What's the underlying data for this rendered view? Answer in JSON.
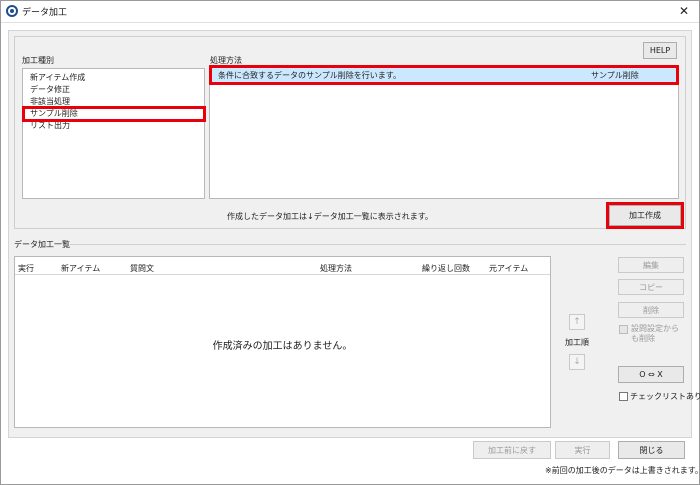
{
  "window": {
    "title": "データ加工",
    "close_glyph": "✕"
  },
  "processing_type": {
    "header": "加工種別",
    "items": [
      "新アイテム作成",
      "データ修正",
      "非該当処理",
      "サンプル削除",
      "リスト出力"
    ],
    "selected_index": 3
  },
  "method": {
    "header": "処理方法",
    "help_label": "HELP",
    "row_description": "条件に合致するデータのサンプル削除を行います。",
    "row_name": "サンプル削除"
  },
  "info_text": "作成したデータ加工は↓データ加工一覧に表示されます。",
  "create_button": "加工作成",
  "list": {
    "header": "データ加工一覧",
    "columns": [
      "実行",
      "新アイテム",
      "質問文",
      "処理方法",
      "繰り返し回数",
      "元アイテム"
    ],
    "empty_message": "作成済みの加工はありません。"
  },
  "side": {
    "edit": "編集",
    "copy": "コピー",
    "delete": "削除",
    "delete_settings_label": "設問設定からも削除",
    "order_up_glyph": "↑",
    "order_down_glyph": "↓",
    "order_label": "加工順",
    "ox_label": "O ⇔ X",
    "checklist_label": "チェックリストあり"
  },
  "footer": {
    "revert": "加工前に戻す",
    "run": "実行",
    "close": "閉じる",
    "note": "※前回の加工後のデータは上書きされます。"
  },
  "colors": {
    "highlight": "#e8000b",
    "selection": "#cce8ff",
    "app_icon": "#1f4e8c"
  }
}
